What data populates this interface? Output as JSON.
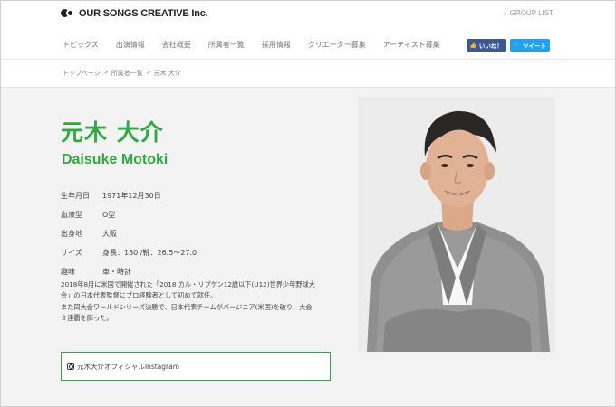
{
  "header": {
    "logo_text": "OUR SONGS CREATIVE Inc.",
    "group_list": "GROUP LIST"
  },
  "nav": {
    "items": [
      "トピックス",
      "出演情報",
      "会社概要",
      "所属者一覧",
      "採用情報",
      "クリエーター募集",
      "アーティスト募集"
    ]
  },
  "social": {
    "like_label": "いいね！",
    "tweet_label": "ツイート"
  },
  "breadcrumb": {
    "items": [
      "トップページ",
      "所属者一覧",
      "元木 大介"
    ],
    "separator": ">"
  },
  "profile": {
    "name_jp": "元木 大介",
    "name_en": "Daisuke Motoki",
    "rows": [
      {
        "label": "生年月日",
        "value": "1971年12月30日"
      },
      {
        "label": "血液型",
        "value": "O型"
      },
      {
        "label": "出身地",
        "value": "大阪"
      },
      {
        "label": "サイズ",
        "value": "身長：180 /靴：26.5～27.0"
      },
      {
        "label": "趣味",
        "value": "車・時計"
      }
    ],
    "bio": [
      "2018年8月に米国で開催された「2018 カル・リプケン12歳以下(U12)世界少年野球大",
      "会」の日本代表監督にプロ経験者として初めて就任。",
      "また同大会ワールドシリーズ決勝で、日本代表チームがバージニア(米国)を破り、大会",
      "３連覇を飾った。"
    ],
    "instagram_label": "元木大介オフィシャルInstagram"
  },
  "colors": {
    "accent_green": "#2eaa3f",
    "facebook_blue": "#3b5998",
    "twitter_blue": "#1da1f2",
    "background_gray": "#f3f3f3"
  }
}
